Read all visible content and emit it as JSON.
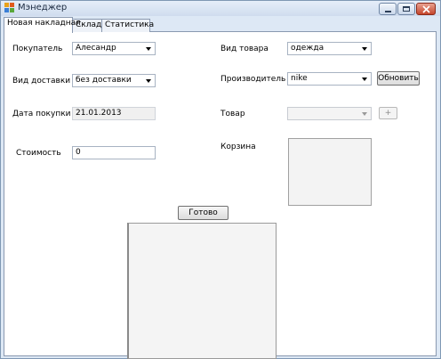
{
  "window": {
    "title": "Мэнеджер",
    "icon": "app-window-icon"
  },
  "tabs": [
    {
      "label": "Новая накладная"
    },
    {
      "label": "Склад"
    },
    {
      "label": "Статистика"
    }
  ],
  "form": {
    "buyer": {
      "label": "Покупатель",
      "value": "Алесандр"
    },
    "delivery": {
      "label": "Вид доставки",
      "value": "без доставки"
    },
    "purchase_date": {
      "label": "Дата покупки",
      "value": "21.01.2013"
    },
    "cost": {
      "label": "Стоимость",
      "value": "0"
    },
    "product_type": {
      "label": "Вид товара",
      "value": "одежда"
    },
    "manufacturer": {
      "label": "Производитель",
      "value": "nike"
    },
    "product": {
      "label": "Товар",
      "value": ""
    },
    "cart": {
      "label": "Корзина"
    }
  },
  "buttons": {
    "refresh": "Обновить",
    "add": "+",
    "done": "Готово"
  }
}
